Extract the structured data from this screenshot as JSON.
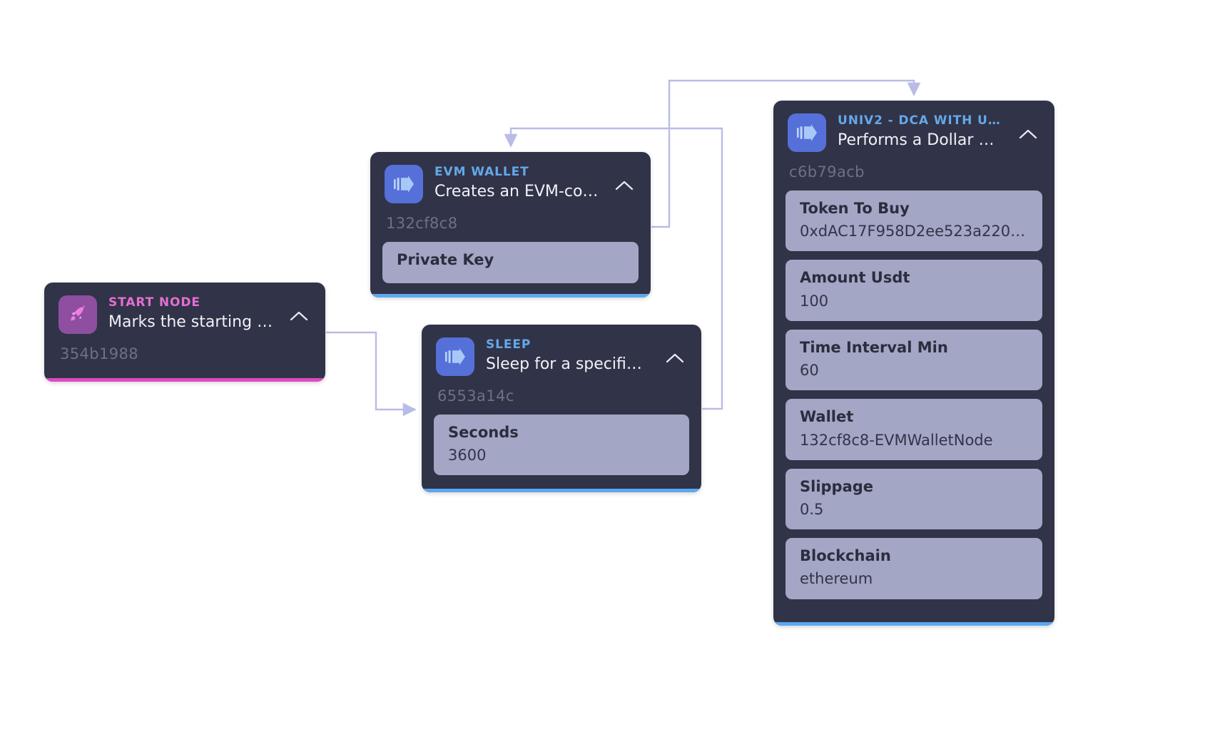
{
  "canvas": {
    "background": "#ffffff",
    "edge_color": "#b9bce6"
  },
  "palette": {
    "node_bg": "#313348",
    "field_bg": "#a3a6c4",
    "kind_pink": "#e36fd0",
    "kind_blue": "#64a8e8",
    "accent_pink": "#e148c4",
    "accent_blue": "#5aa9ef",
    "icon_start_bg": "#8e4fa0",
    "icon_blue_bg": "#5570d8",
    "id_text": "#6d7088"
  },
  "nodes": {
    "start": {
      "kind": "START NODE",
      "description": "Marks the starting poin...",
      "id": "354b1988",
      "icon": "rocket-icon",
      "collapse_icon": "chevron-up-icon",
      "accent": "pink",
      "fields": []
    },
    "wallet": {
      "kind": "EVM WALLET",
      "description": "Creates an EVM-comp...",
      "id": "132cf8c8",
      "icon": "play-forward-icon",
      "collapse_icon": "chevron-up-icon",
      "accent": "blue",
      "fields": [
        {
          "label": "Private Key",
          "value": ""
        }
      ]
    },
    "sleep": {
      "kind": "SLEEP",
      "description": "Sleep for a specified n...",
      "id": "6553a14c",
      "icon": "play-forward-icon",
      "collapse_icon": "chevron-up-icon",
      "accent": "blue",
      "fields": [
        {
          "label": "Seconds",
          "value": "3600"
        }
      ]
    },
    "univ2": {
      "kind": "UNIV2 - DCA WITH USDT",
      "description": "Performs a Dollar Cost ...",
      "id": "c6b79acb",
      "icon": "play-forward-icon",
      "collapse_icon": "chevron-up-icon",
      "accent": "blue",
      "fields": [
        {
          "label": "Token To Buy",
          "value": "0xdAC17F958D2ee523a2206..."
        },
        {
          "label": "Amount Usdt",
          "value": "100"
        },
        {
          "label": "Time Interval Min",
          "value": "60"
        },
        {
          "label": "Wallet",
          "value": "132cf8c8-EVMWalletNode"
        },
        {
          "label": "Slippage",
          "value": "0.5"
        },
        {
          "label": "Blockchain",
          "value": "ethereum"
        }
      ]
    }
  },
  "edges": [
    {
      "from": "start",
      "to": "sleep"
    },
    {
      "from": "sleep",
      "to": "univ2"
    },
    {
      "from": "wallet",
      "to": "univ2"
    },
    {
      "from": "sleep",
      "to": "wallet"
    }
  ]
}
